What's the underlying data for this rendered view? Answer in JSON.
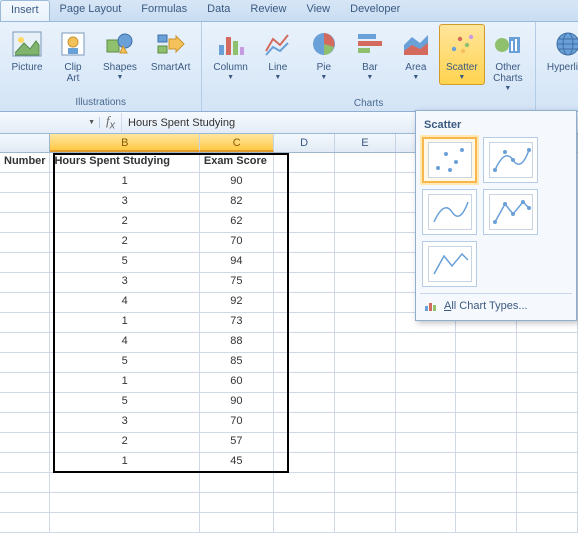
{
  "ribbon": {
    "tabs": [
      "Insert",
      "Page Layout",
      "Formulas",
      "Data",
      "Review",
      "View",
      "Developer"
    ],
    "active_tab": "Insert",
    "groups": {
      "illustrations": {
        "label": "Illustrations",
        "items": {
          "picture": "Picture",
          "clipart_line1": "Clip",
          "clipart_line2": "Art",
          "shapes": "Shapes",
          "smartart": "SmartArt"
        }
      },
      "charts": {
        "label": "Charts",
        "items": {
          "column": "Column",
          "line": "Line",
          "pie": "Pie",
          "bar": "Bar",
          "area": "Area",
          "scatter": "Scatter",
          "other_line1": "Other",
          "other_line2": "Charts"
        }
      },
      "links": {
        "hyperlink": "Hyperlink"
      }
    }
  },
  "formula_bar": {
    "content": "Hours Spent Studying"
  },
  "columns": {
    "A_header": "Number",
    "B_header": "Hours Spent Studying",
    "C_header": "Exam Score"
  },
  "data_rows": [
    {
      "b": "1",
      "c": "90"
    },
    {
      "b": "3",
      "c": "82"
    },
    {
      "b": "2",
      "c": "62"
    },
    {
      "b": "2",
      "c": "70"
    },
    {
      "b": "5",
      "c": "94"
    },
    {
      "b": "3",
      "c": "75"
    },
    {
      "b": "4",
      "c": "92"
    },
    {
      "b": "1",
      "c": "73"
    },
    {
      "b": "4",
      "c": "88"
    },
    {
      "b": "5",
      "c": "85"
    },
    {
      "b": "1",
      "c": "60"
    },
    {
      "b": "5",
      "c": "90"
    },
    {
      "b": "3",
      "c": "70"
    },
    {
      "b": "2",
      "c": "57"
    },
    {
      "b": "1",
      "c": "45"
    }
  ],
  "col_letters": {
    "b": "B",
    "c": "C",
    "d": "D",
    "e": "E"
  },
  "scatter_menu": {
    "title": "Scatter",
    "footer_prefix": "A",
    "footer_rest": "ll Chart Types..."
  },
  "chart_data": {
    "type": "table",
    "title": "",
    "columns": [
      "Number",
      "Hours Spent Studying",
      "Exam Score"
    ],
    "series": [
      {
        "name": "Hours Spent Studying",
        "values": [
          1,
          3,
          2,
          2,
          5,
          3,
          4,
          1,
          4,
          5,
          1,
          5,
          3,
          2,
          1
        ]
      },
      {
        "name": "Exam Score",
        "values": [
          90,
          82,
          62,
          70,
          94,
          75,
          92,
          73,
          88,
          85,
          60,
          90,
          70,
          57,
          45
        ]
      }
    ]
  }
}
